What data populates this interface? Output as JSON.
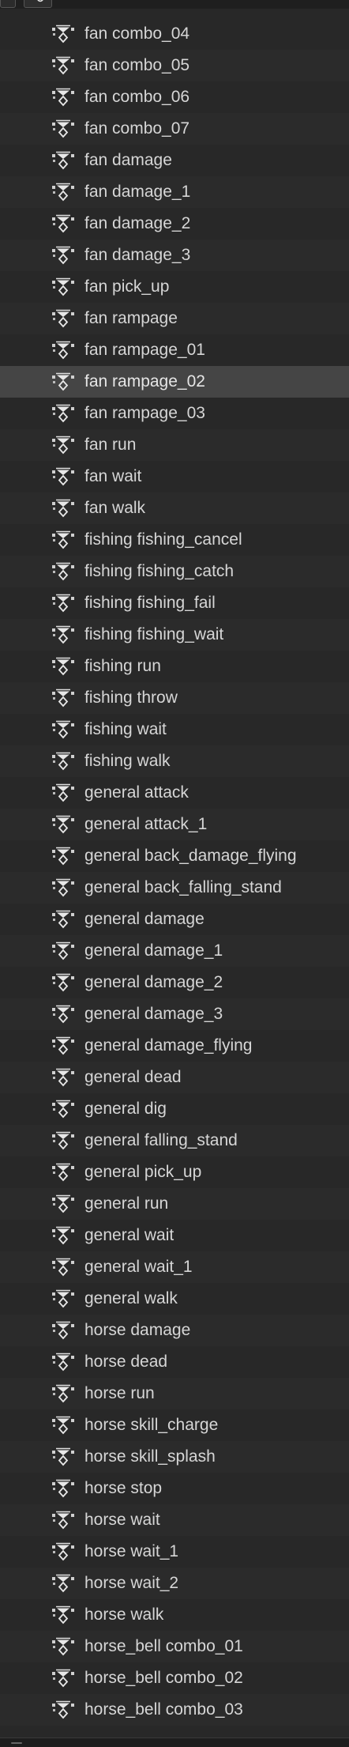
{
  "toolbar": {
    "icon": "filter-icon"
  },
  "rows": [
    "fan combo_04",
    "fan combo_05",
    "fan combo_06",
    "fan combo_07",
    "fan damage",
    "fan damage_1",
    "fan damage_2",
    "fan damage_3",
    "fan pick_up",
    "fan rampage",
    "fan rampage_01",
    "fan rampage_02",
    "fan rampage_03",
    "fan run",
    "fan wait",
    "fan walk",
    "fishing fishing_cancel",
    "fishing fishing_catch",
    "fishing fishing_fail",
    "fishing fishing_wait",
    "fishing run",
    "fishing throw",
    "fishing wait",
    "fishing walk",
    "general attack",
    "general attack_1",
    "general back_damage_flying",
    "general back_falling_stand",
    "general damage",
    "general damage_1",
    "general damage_2",
    "general damage_3",
    "general damage_flying",
    "general dead",
    "general dig",
    "general falling_stand",
    "general pick_up",
    "general run",
    "general wait",
    "general wait_1",
    "general walk",
    "horse damage",
    "horse dead",
    "horse run",
    "horse skill_charge",
    "horse skill_splash",
    "horse stop",
    "horse wait",
    "horse wait_1",
    "horse wait_2",
    "horse walk",
    "horse_bell combo_01",
    "horse_bell combo_02",
    "horse_bell combo_03"
  ],
  "selected_row": "fan rampage_02",
  "row_icon": "action-icon",
  "colors": {
    "background": "#282828",
    "row_alt": "#2b2b2b",
    "selected": "#454545",
    "text": "#d6d6d6"
  }
}
